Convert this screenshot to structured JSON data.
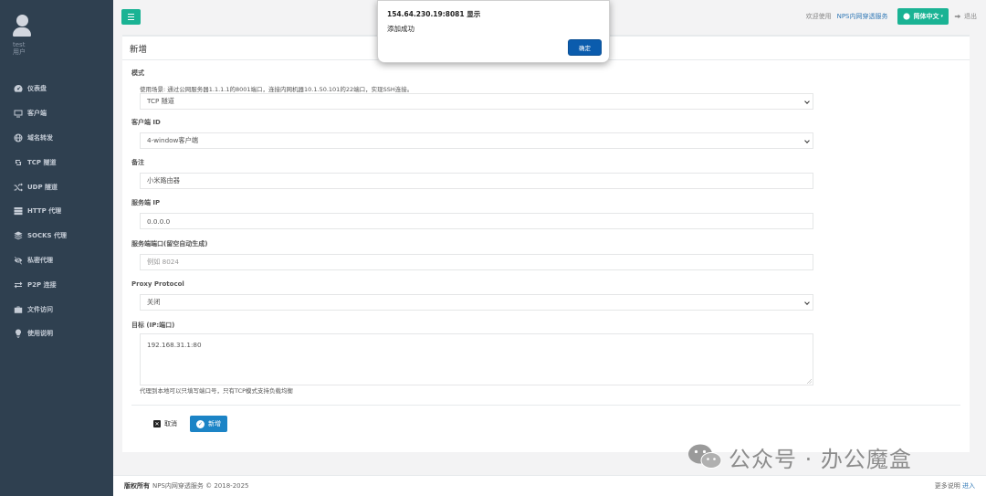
{
  "user": {
    "name": "test",
    "role": "用户"
  },
  "sidebar": {
    "items": [
      {
        "label": "仪表盘",
        "icon": "dashboard-icon"
      },
      {
        "label": "客户端",
        "icon": "monitor-icon"
      },
      {
        "label": "域名转发",
        "icon": "globe-icon"
      },
      {
        "label": "TCP 隧道",
        "icon": "retweet-icon"
      },
      {
        "label": "UDP 隧道",
        "icon": "shuffle-icon"
      },
      {
        "label": "HTTP 代理",
        "icon": "server-icon"
      },
      {
        "label": "SOCKS 代理",
        "icon": "layers-icon"
      },
      {
        "label": "私密代理",
        "icon": "eye-slash-icon"
      },
      {
        "label": "P2P 连接",
        "icon": "exchange-icon"
      },
      {
        "label": "文件访问",
        "icon": "briefcase-icon"
      },
      {
        "label": "使用说明",
        "icon": "lightbulb-icon"
      }
    ]
  },
  "topbar": {
    "welcome": "欢迎使用",
    "brand": "NPS内网穿透服务",
    "language": "简体中文",
    "logout": "退出"
  },
  "form": {
    "title": "新增",
    "mode_label": "模式",
    "mode_hint": "使用场景: 通过公网服务器1.1.1.1的8001端口，连接内网机器10.1.50.101的22端口，实现SSH连接。",
    "mode_value": "TCP 隧道",
    "client_label": "客户端 ID",
    "client_value": "4-window客户端",
    "remark_label": "备注",
    "remark_value": "小米路由器",
    "server_ip_label": "服务端 IP",
    "server_ip_value": "0.0.0.0",
    "server_port_label": "服务端端口(留空自动生成)",
    "server_port_placeholder": "例如 8024",
    "proxy_protocol_label": "Proxy Protocol",
    "proxy_protocol_value": "关闭",
    "target_label": "目标 (IP:端口)",
    "target_value": "192.168.31.1:80",
    "target_hint": "代理到本地可以只填写端口号，只有TCP模式支持负载均衡",
    "cancel_label": "取消",
    "submit_label": "新增"
  },
  "footer": {
    "copyright_bold": "版权所有",
    "copyright_text": "NPS内网穿透服务 © 2018-2025",
    "more_text": "更多说明",
    "more_link": "进入"
  },
  "watermark": {
    "text": "公众号 · 办公魔盒"
  },
  "alert": {
    "title": "154.64.230.19:8081 显示",
    "message": "添加成功",
    "ok_label": "确定"
  },
  "colors": {
    "sidebar": "#2f4050",
    "primary": "#1ab394",
    "button_blue": "#1c84c6"
  }
}
